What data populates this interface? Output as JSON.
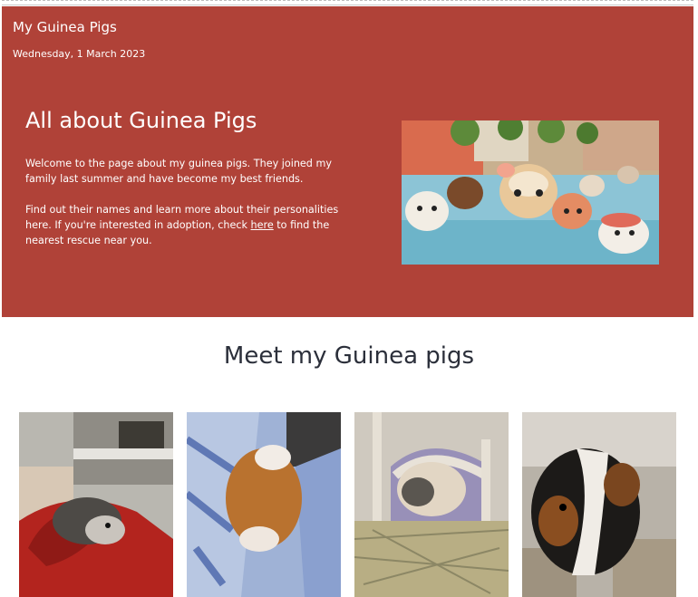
{
  "header": {
    "site_title": "My Guinea Pigs",
    "date": "Wednesday, 1 March 2023"
  },
  "hero": {
    "heading": "All about Guinea Pigs",
    "paragraph1": "Welcome to the page about my guinea pigs. They joined my family last summer and have become my best friends.",
    "paragraph2_before": "Find out their names and learn more about their personalities here. If you're interested in adoption, check ",
    "paragraph2_link": "here",
    "paragraph2_after": " to find the nearest rescue near you.",
    "image_icon": "guinea-pig-toys-image"
  },
  "gallery": {
    "title": "Meet my Guinea pigs",
    "photos": [
      {
        "icon": "guinea-pig-photo-1"
      },
      {
        "icon": "guinea-pig-photo-2"
      },
      {
        "icon": "guinea-pig-photo-3"
      },
      {
        "icon": "guinea-pig-photo-4"
      }
    ]
  }
}
